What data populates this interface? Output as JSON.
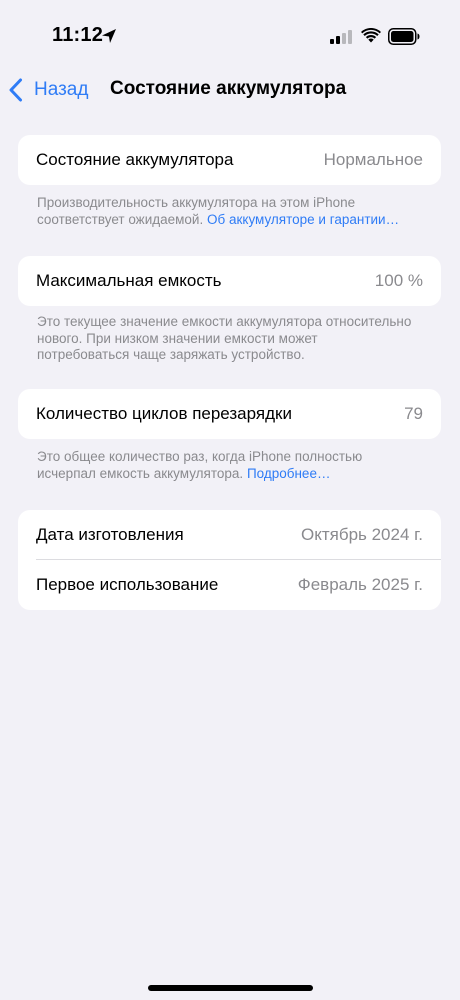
{
  "status_bar": {
    "time": "11:12",
    "icons": [
      "location-arrow-icon",
      "cellular-signal-icon",
      "wifi-icon",
      "battery-icon"
    ]
  },
  "nav": {
    "back_label": "Назад",
    "title": "Состояние аккумулятора"
  },
  "sections": {
    "health": {
      "label": "Состояние аккумулятора",
      "value": "Нормальное",
      "footnote_text": "Производительность аккумулятора на этом iPhone соответствует ожидаемой.",
      "footnote_link": "Об аккумуляторе и гарантии…"
    },
    "capacity": {
      "label": "Максимальная емкость",
      "value": "100 %",
      "footnote_text": "Это текущее значение емкости аккумулятора относительно нового. При низком значении емкости может потребоваться чаще заряжать устройство."
    },
    "cycles": {
      "label": "Количество циклов перезарядки",
      "value": "79",
      "footnote_text": "Это общее количество раз, когда iPhone полностью исчерпал емкость аккумулятора.",
      "footnote_link": "Подробнее…"
    },
    "dates": {
      "manufacture_label": "Дата изготовления",
      "manufacture_value": "Октябрь 2024 г.",
      "first_use_label": "Первое использование",
      "first_use_value": "Февраль 2025 г."
    }
  },
  "colors": {
    "background": "#f2f1f7",
    "card": "#ffffff",
    "accent": "#2f7cf6",
    "secondary_text": "#8a8a8e"
  }
}
